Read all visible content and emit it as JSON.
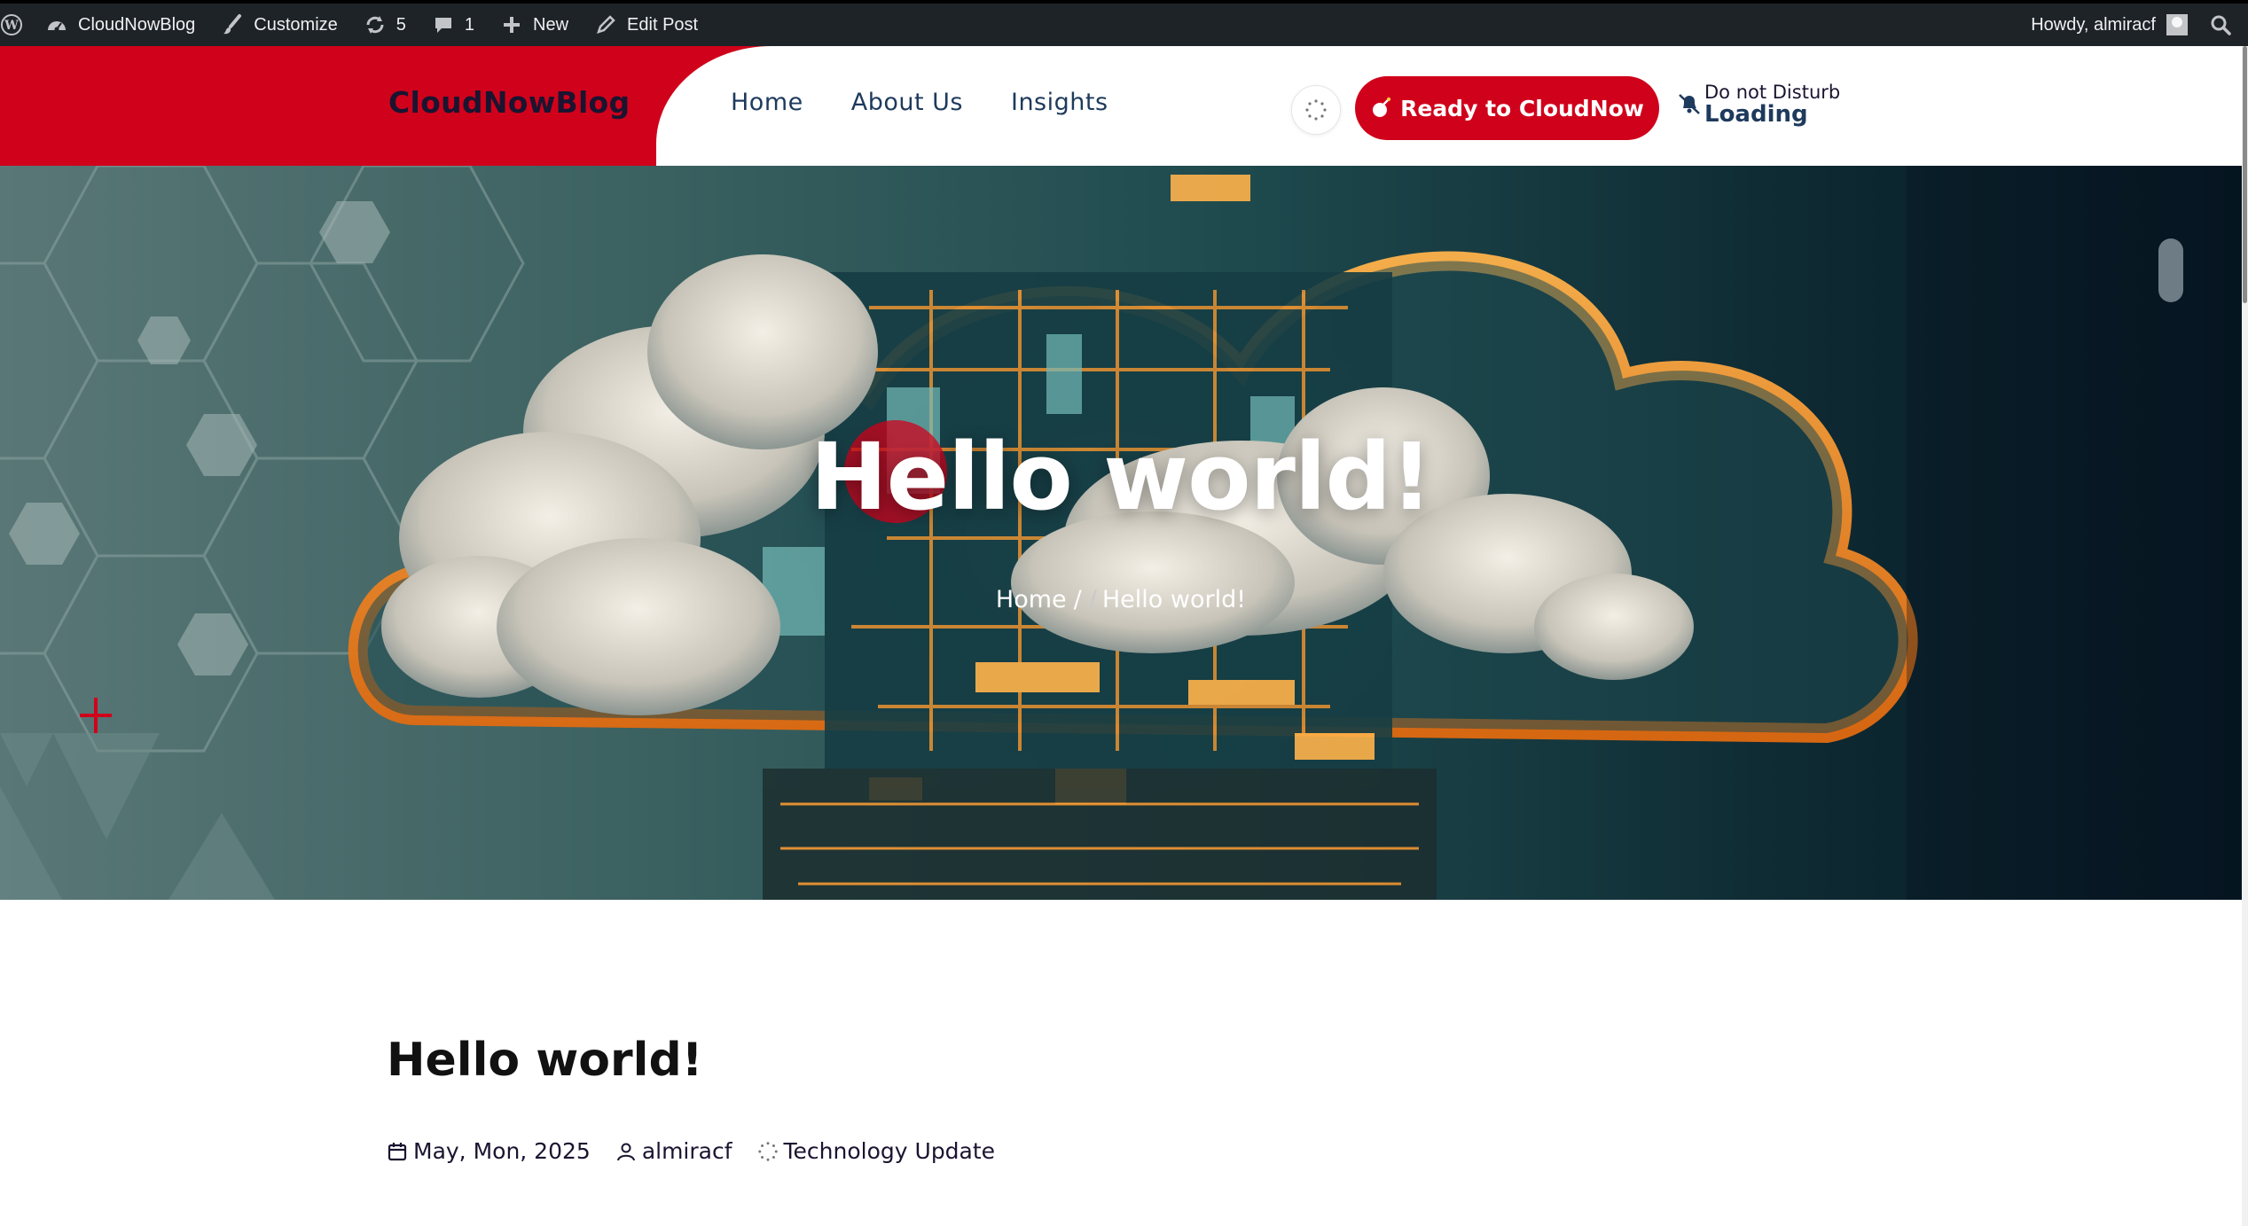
{
  "admin_bar": {
    "site_name": "CloudNowBlog",
    "customize": "Customize",
    "updates_count": "5",
    "comments_count": "1",
    "new_label": "New",
    "edit_post": "Edit Post",
    "howdy": "Howdy, almiracf"
  },
  "header": {
    "logo": "CloudNowBlog",
    "nav": [
      "Home",
      "About Us",
      "Insights"
    ],
    "cta_label": "Ready to CloudNow",
    "dnd_title": "Do not Disturb",
    "dnd_status": "Loading"
  },
  "hero": {
    "title": "Hello world!",
    "breadcrumb_home": "Home",
    "breadcrumb_sep": "/",
    "breadcrumb_current": "Hello world!"
  },
  "post": {
    "title": "Hello world!",
    "date": "May, Mon, 2025",
    "author": "almiracf",
    "category": "Technology Update"
  },
  "colors": {
    "brand_red": "#d0021b",
    "admin_bar": "#1d2327",
    "nav_text": "#1e3a5c"
  }
}
